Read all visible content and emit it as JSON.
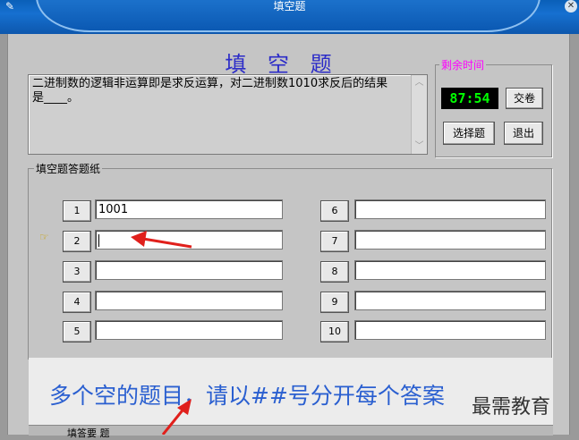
{
  "window": {
    "title": "填空题"
  },
  "heading": "填 空 题",
  "question": {
    "text": "二进制数的逻辑非运算即是求反运算，对二进制数1010求反后的结果是____。"
  },
  "timer": {
    "legend": "剩余时间",
    "value": "87:54"
  },
  "buttons": {
    "submit": "交卷",
    "select_question": "选择题",
    "exit": "退出"
  },
  "answer_sheet": {
    "legend": "填空题答题纸",
    "left": [
      {
        "num": "1",
        "value": "1001"
      },
      {
        "num": "2",
        "value": ""
      },
      {
        "num": "3",
        "value": ""
      },
      {
        "num": "4",
        "value": ""
      },
      {
        "num": "5",
        "value": ""
      }
    ],
    "right": [
      {
        "num": "6",
        "value": ""
      },
      {
        "num": "7",
        "value": ""
      },
      {
        "num": "8",
        "value": ""
      },
      {
        "num": "9",
        "value": ""
      },
      {
        "num": "10",
        "value": ""
      }
    ]
  },
  "caption": "多个空的题目，请以##号分开每个答案",
  "watermark": "最需教育",
  "bottom_text": "填答要 题"
}
